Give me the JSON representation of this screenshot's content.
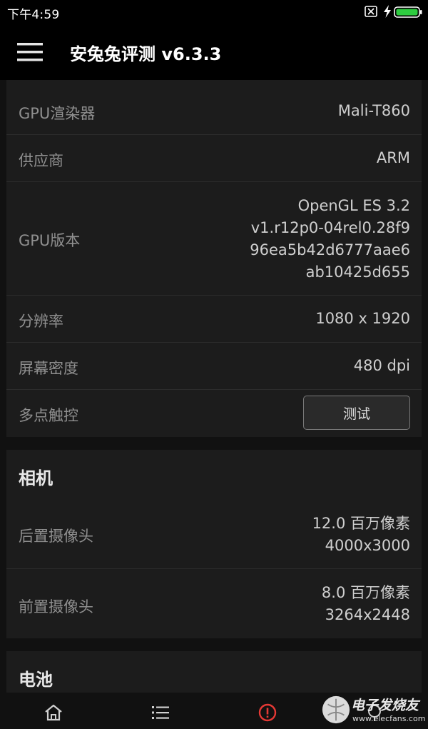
{
  "status_bar": {
    "time": "下午4:59",
    "icons": [
      "sim-card-x-icon",
      "charging-bolt-icon",
      "battery-icon"
    ],
    "battery_color": "#2ecc40"
  },
  "app_bar": {
    "menu_icon": "hamburger-menu-icon",
    "title": "安兔兔评测 v6.3.3"
  },
  "gpu_card": {
    "rows": [
      {
        "label": "GPU渲染器",
        "value": "Mali-T860"
      },
      {
        "label": "供应商",
        "value": "ARM"
      },
      {
        "label": "GPU版本",
        "value_lines": [
          "OpenGL ES 3.2",
          "v1.r12p0-04rel0.28f9",
          "96ea5b42d6777aae6",
          "ab10425d655"
        ]
      },
      {
        "label": "分辨率",
        "value": "1080 x 1920"
      },
      {
        "label": "屏幕密度",
        "value": "480 dpi"
      },
      {
        "label": "多点触控",
        "button": "测试"
      }
    ]
  },
  "camera_card": {
    "title": "相机",
    "rows": [
      {
        "label": "后置摄像头",
        "value_lines": [
          "12.0 百万像素",
          "4000x3000"
        ]
      },
      {
        "label": "前置摄像头",
        "value_lines": [
          "8.0 百万像素",
          "3264x2448"
        ]
      }
    ]
  },
  "battery_card": {
    "title": "电池"
  },
  "bottom_nav": {
    "icons": [
      "home-icon",
      "list-icon",
      "alert-icon",
      "tests-icon"
    ],
    "active_color": "#e53935"
  },
  "watermark": {
    "text": "电子发烧友",
    "url": "www.elecfans.com"
  }
}
